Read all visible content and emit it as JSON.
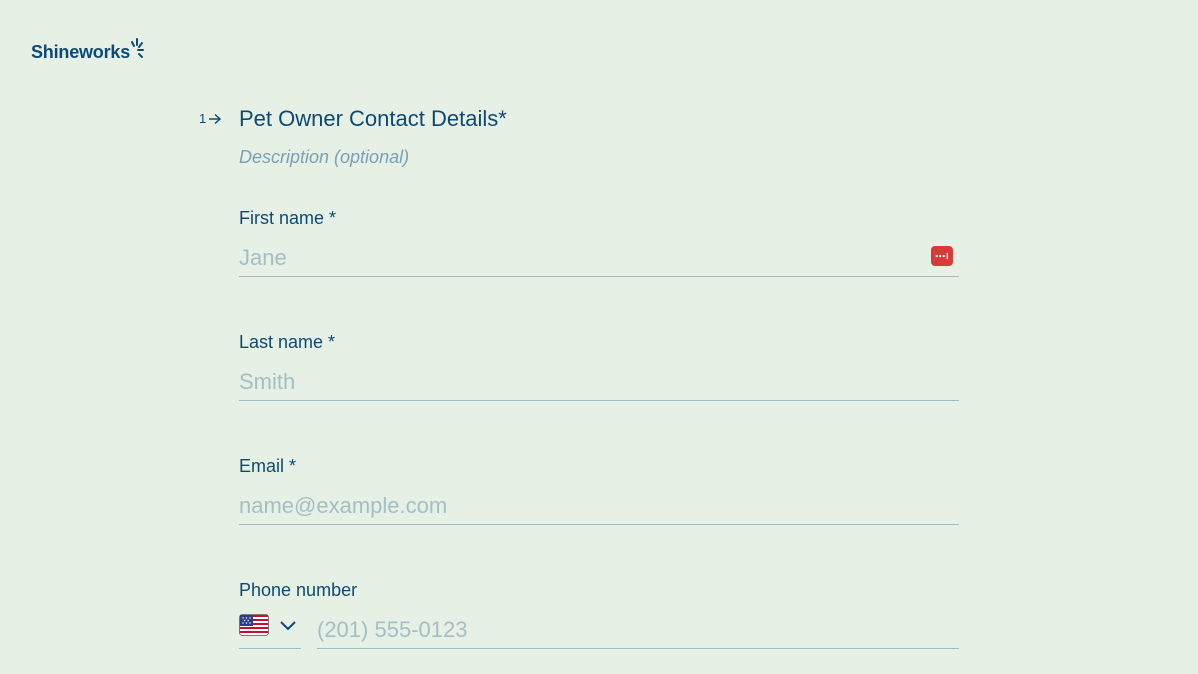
{
  "brand": {
    "name": "Shineworks",
    "color": "#0b4a78"
  },
  "question": {
    "number": "1",
    "title": "Pet Owner Contact Details*",
    "description": "Description (optional)"
  },
  "fields": {
    "first_name": {
      "label": "First name *",
      "placeholder": "Jane",
      "value": ""
    },
    "last_name": {
      "label": "Last name *",
      "placeholder": "Smith",
      "value": ""
    },
    "email": {
      "label": "Email *",
      "placeholder": "name@example.com",
      "value": ""
    },
    "phone": {
      "label": "Phone number",
      "placeholder": "(201) 555-0123",
      "value": "",
      "country": "US"
    }
  },
  "icons": {
    "arrow": "arrow-right-icon",
    "password_manager": "password-manager-icon",
    "flag": "us-flag-icon",
    "chevron": "chevron-down-icon"
  },
  "colors": {
    "background": "#e7f0e4",
    "text": "#0b4a78",
    "placeholder": "#a3bfc6",
    "underline": "#9fbcc4",
    "password_icon": "#d93a3a"
  }
}
